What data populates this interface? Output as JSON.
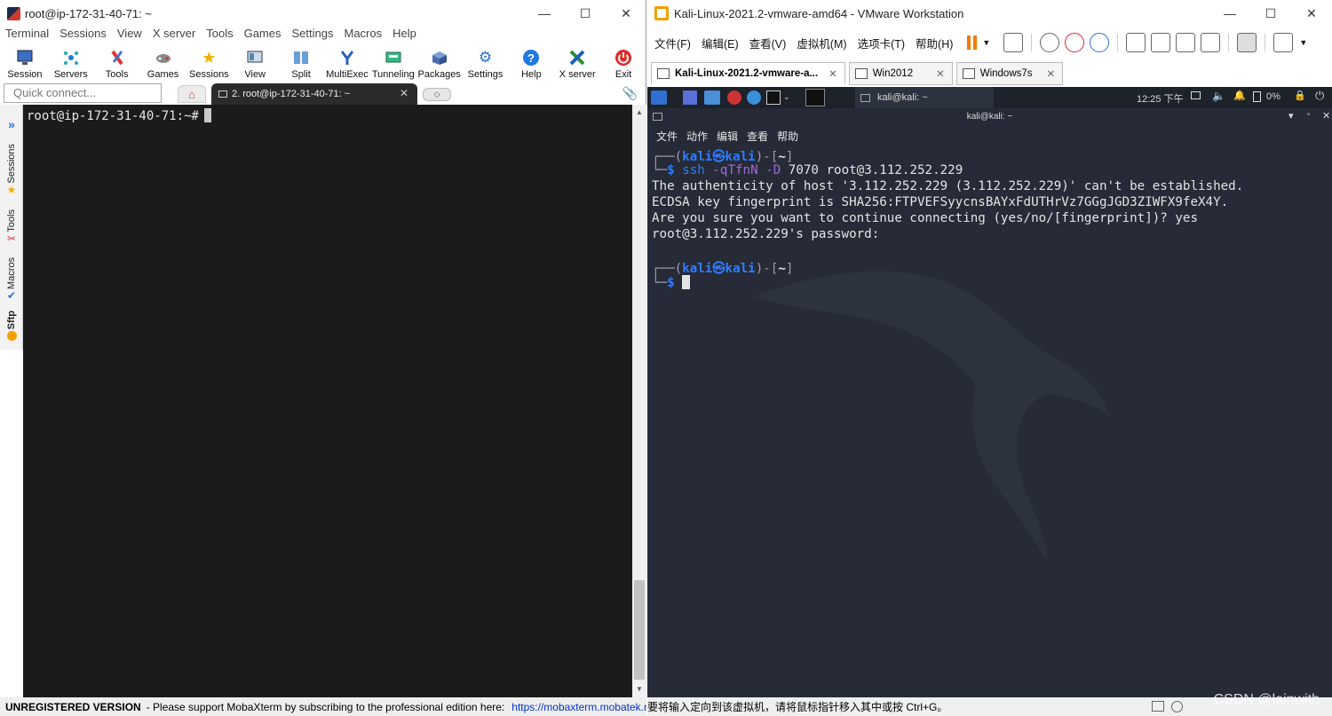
{
  "moba": {
    "window_title": "root@ip-172-31-40-71: ~",
    "menu": [
      "Terminal",
      "Sessions",
      "View",
      "X server",
      "Tools",
      "Games",
      "Settings",
      "Macros",
      "Help"
    ],
    "toolbar": [
      {
        "label": "Session",
        "icon": "session-icon"
      },
      {
        "label": "Servers",
        "icon": "servers-icon"
      },
      {
        "label": "Tools",
        "icon": "tools-icon"
      },
      {
        "label": "Games",
        "icon": "games-icon"
      },
      {
        "label": "Sessions",
        "icon": "star-icon"
      },
      {
        "label": "View",
        "icon": "view-icon"
      },
      {
        "label": "Split",
        "icon": "split-icon"
      },
      {
        "label": "MultiExec",
        "icon": "multiexec-icon"
      },
      {
        "label": "Tunneling",
        "icon": "tunneling-icon"
      },
      {
        "label": "Packages",
        "icon": "packages-icon"
      },
      {
        "label": "Settings",
        "icon": "gear-icon"
      },
      {
        "label": "Help",
        "icon": "help-icon"
      },
      {
        "label": "X server",
        "icon": "xserver-icon"
      },
      {
        "label": "Exit",
        "icon": "power-icon"
      }
    ],
    "quick_connect_placeholder": "Quick connect...",
    "tab_label": "2. root@ip-172-31-40-71: ~",
    "sidebar": [
      "Sessions",
      "Tools",
      "Macros",
      "Sftp"
    ],
    "prompt": "root@ip-172-31-40-71:~#",
    "status_bold": "UNREGISTERED VERSION",
    "status_text": "-  Please support MobaXterm by subscribing to the professional edition here:",
    "status_link": "https://mobaxterm.mobatek.net"
  },
  "vmware": {
    "window_title": "Kali-Linux-2021.2-vmware-amd64 - VMware Workstation",
    "menu": [
      "文件(F)",
      "编辑(E)",
      "查看(V)",
      "虚拟机(M)",
      "选项卡(T)",
      "帮助(H)"
    ],
    "tabs": [
      "Kali-Linux-2021.2-vmware-a...",
      "Win2012",
      "Windows7s"
    ],
    "panel_task": "kali@kali: ~",
    "panel_time": "12:25 下午",
    "panel_battery": "0%",
    "term_title": "kali@kali: ~",
    "term_menu": [
      "文件",
      "动作",
      "编辑",
      "查看",
      "帮助"
    ],
    "user": "kali",
    "host": "kali",
    "dir": "~",
    "cmd_name": "ssh",
    "cmd_opts": "-qTfnN -D",
    "cmd_args": "7070 root@3.112.252.229",
    "out1": "The authenticity of host '3.112.252.229 (3.112.252.229)' can't be established.",
    "out2": "ECDSA key fingerprint is SHA256:FTPVEFSyycnsBAYxFdUTHrVz7GGgJGD3ZIWFX9feX4Y.",
    "out3": "Are you sure you want to continue connecting (yes/no/[fingerprint])? yes",
    "out4": "root@3.112.252.229's password:",
    "status_text": "要将输入定向到该虚拟机，请将鼠标指针移入其中或按 Ctrl+G。",
    "watermark": "CSDN @lainwith"
  }
}
